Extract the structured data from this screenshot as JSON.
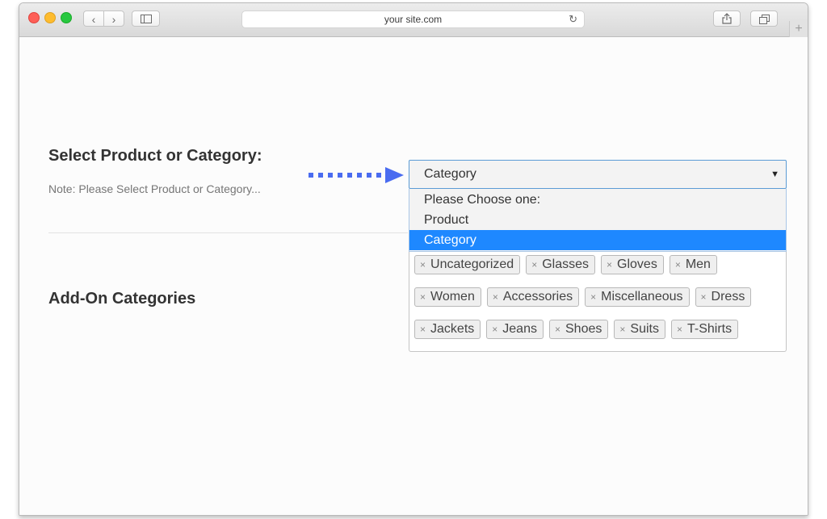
{
  "browser": {
    "url": "your site.com",
    "back_icon": "‹",
    "forward_icon": "›",
    "reload_icon": "↻",
    "new_tab_icon": "+"
  },
  "form": {
    "select_heading": "Select Product or Category:",
    "note": "Note: Please Select Product or Category...",
    "addon_heading": "Add-On Categories",
    "select_value": "Category",
    "caret": "▼",
    "options": [
      {
        "label": "Please Choose one:",
        "selected": false
      },
      {
        "label": "Product",
        "selected": false
      },
      {
        "label": "Category",
        "selected": true
      }
    ],
    "remove_symbol": "×",
    "tags": [
      "Uncategorized",
      "Glasses",
      "Gloves",
      "Men",
      "Women",
      "Accessories",
      "Miscellaneous",
      "Dress",
      "Jackets",
      "Jeans",
      "Shoes",
      "Suits",
      "T-Shirts"
    ]
  },
  "colors": {
    "highlight": "#1e88ff",
    "arrow": "#4a6cf0"
  }
}
